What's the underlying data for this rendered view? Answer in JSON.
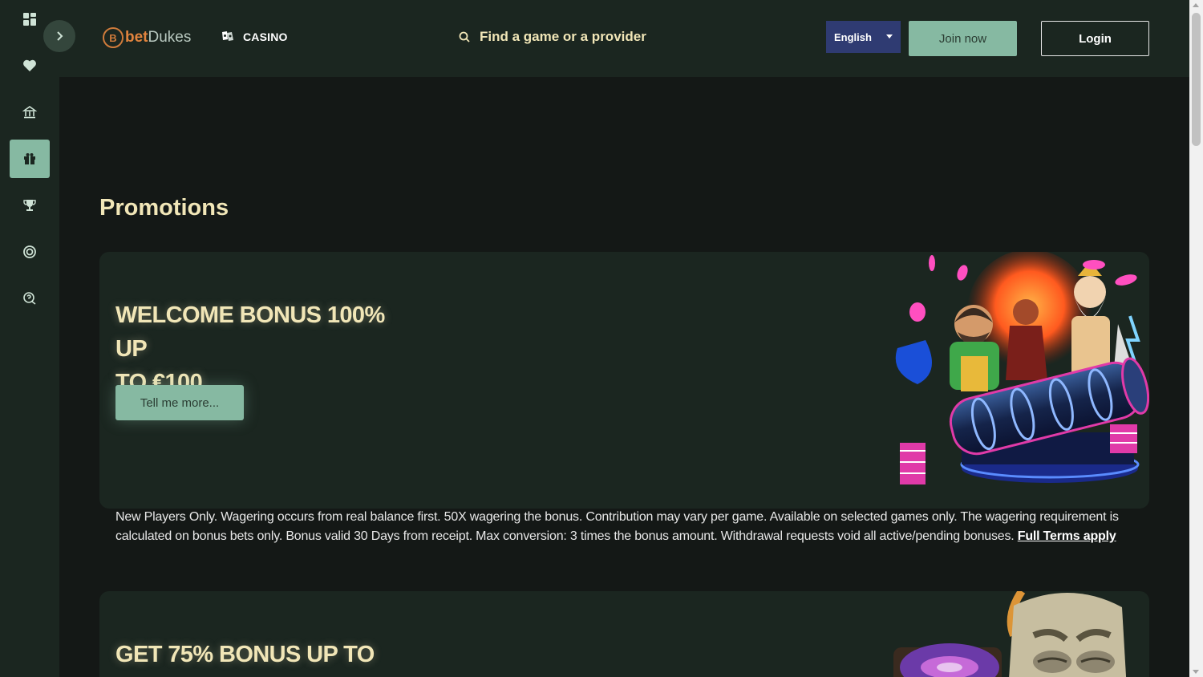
{
  "header": {
    "logo": {
      "bet": "bet",
      "dukes": "Dukes",
      "mark": "B"
    },
    "casino_label": "CASINO",
    "search_placeholder": "Find a game or a provider",
    "language": "English",
    "join_label": "Join now",
    "login_label": "Login"
  },
  "sidebar": {
    "items": [
      {
        "name": "dashboard",
        "icon": "grid-icon"
      },
      {
        "name": "favorites",
        "icon": "heart-icon"
      },
      {
        "name": "casino",
        "icon": "casino-building-icon"
      },
      {
        "name": "promotions",
        "icon": "gift-icon",
        "active": true
      },
      {
        "name": "tournaments",
        "icon": "trophy-icon"
      },
      {
        "name": "live",
        "icon": "target-icon"
      },
      {
        "name": "support",
        "icon": "chat-help-icon"
      }
    ]
  },
  "main": {
    "title": "Promotions",
    "promos": [
      {
        "title_line1": "WELCOME BONUS 100% UP",
        "title_line2": "TO €100",
        "button": "Tell me more...",
        "terms": "New Players Only. Wagering occurs from real balance first. 50X wagering the bonus. Contribution may vary per game. Available on selected games only. The wagering requirement is calculated on bonus bets only. Bonus valid 30 Days from receipt. Max conversion: 3 times the bonus amount. Withdrawal requests void all active/pending bonuses.",
        "terms_link": "Full Terms apply"
      },
      {
        "title_line1": "GET 75% BONUS UP TO"
      }
    ]
  },
  "colors": {
    "rail_bg": "#1b2620",
    "page_bg": "#141816",
    "accent_green": "#86b9a2",
    "title_cream": "#f1e6b7",
    "language_bg": "#2f3b72",
    "logo_orange": "#e2843e"
  }
}
